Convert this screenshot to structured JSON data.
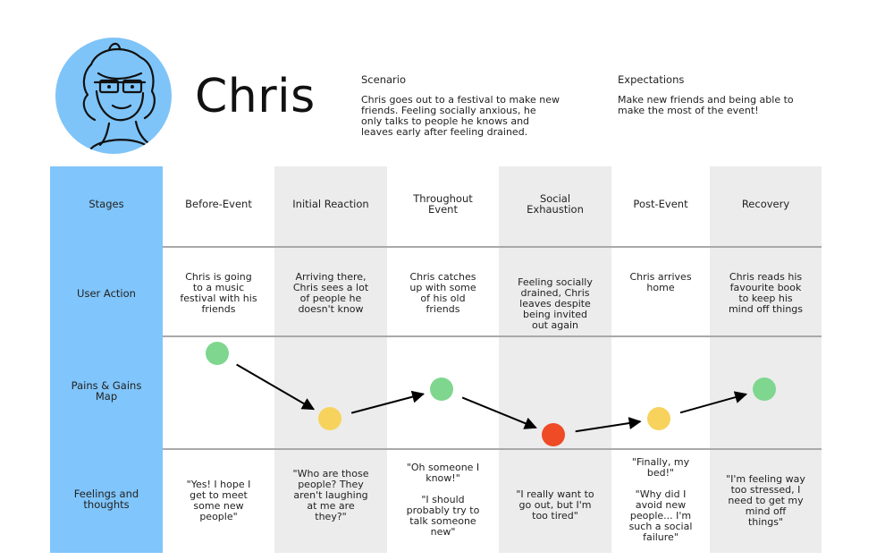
{
  "persona": {
    "name": "Chris",
    "avatar_icon": "persona-avatar-icon",
    "scenario_title": "Scenario",
    "scenario_text": "Chris goes out to a festival to make new\nfriends. Feeling socially anxious, he\nonly talks to people he knows and\nleaves early after feeling drained.",
    "expectations_title": "Expectations",
    "expectations_text": "Make new friends and being able to\nmake the most of the event!"
  },
  "row_labels": [
    "Stages",
    "User Action",
    "Pains & Gains\nMap",
    "Feelings and\nthoughts"
  ],
  "stages": [
    {
      "name": "Before-Event",
      "action": "Chris is going\nto a music\nfestival with his\nfriends",
      "mood": "positive",
      "feeling": "\"Yes! I hope I\nget to meet\nsome new\npeople\""
    },
    {
      "name": "Initial Reaction",
      "action": "Arriving there,\nChris sees a lot\nof people he\ndoesn't know",
      "mood": "neutral",
      "feeling": "\"Who are those\npeople? They\naren't laughing\nat me are\nthey?\""
    },
    {
      "name": "Throughout\nEvent",
      "action": "Chris catches\nup with some\nof his old\nfriends",
      "mood": "positive",
      "feeling": "\"Oh someone I\nknow!\"\n\n\"I should\nprobably try to\ntalk someone\nnew\""
    },
    {
      "name": "Social\nExhaustion",
      "action": "Feeling socially\ndrained, Chris\nleaves despite\nbeing invited\nout again",
      "mood": "negative",
      "feeling": "\"I really want to\ngo out, but I'm\ntoo tired\""
    },
    {
      "name": "Post-Event",
      "action": "Chris arrives\nhome",
      "mood": "neutral",
      "feeling": "\"Finally, my\nbed!\"\n\n\"Why did I\navoid new\npeople... I'm\nsuch a social\nfailure\""
    },
    {
      "name": "Recovery",
      "action": "Chris reads his\nfavourite book\nto keep his\nmind off things",
      "mood": "positive",
      "feeling": "\"I'm feeling way\ntoo stressed, I\nneed to get my\nmind off\nthings\""
    }
  ],
  "colors": {
    "label_column": "#80c5fb",
    "shaded_column": "#ececec",
    "row_divider": "#a9a9a9",
    "avatar_bg": "#7ec4f8",
    "positive": "#7fd68f",
    "neutral": "#f7d35e",
    "negative": "#ee4b26",
    "arrow": "#000000"
  }
}
